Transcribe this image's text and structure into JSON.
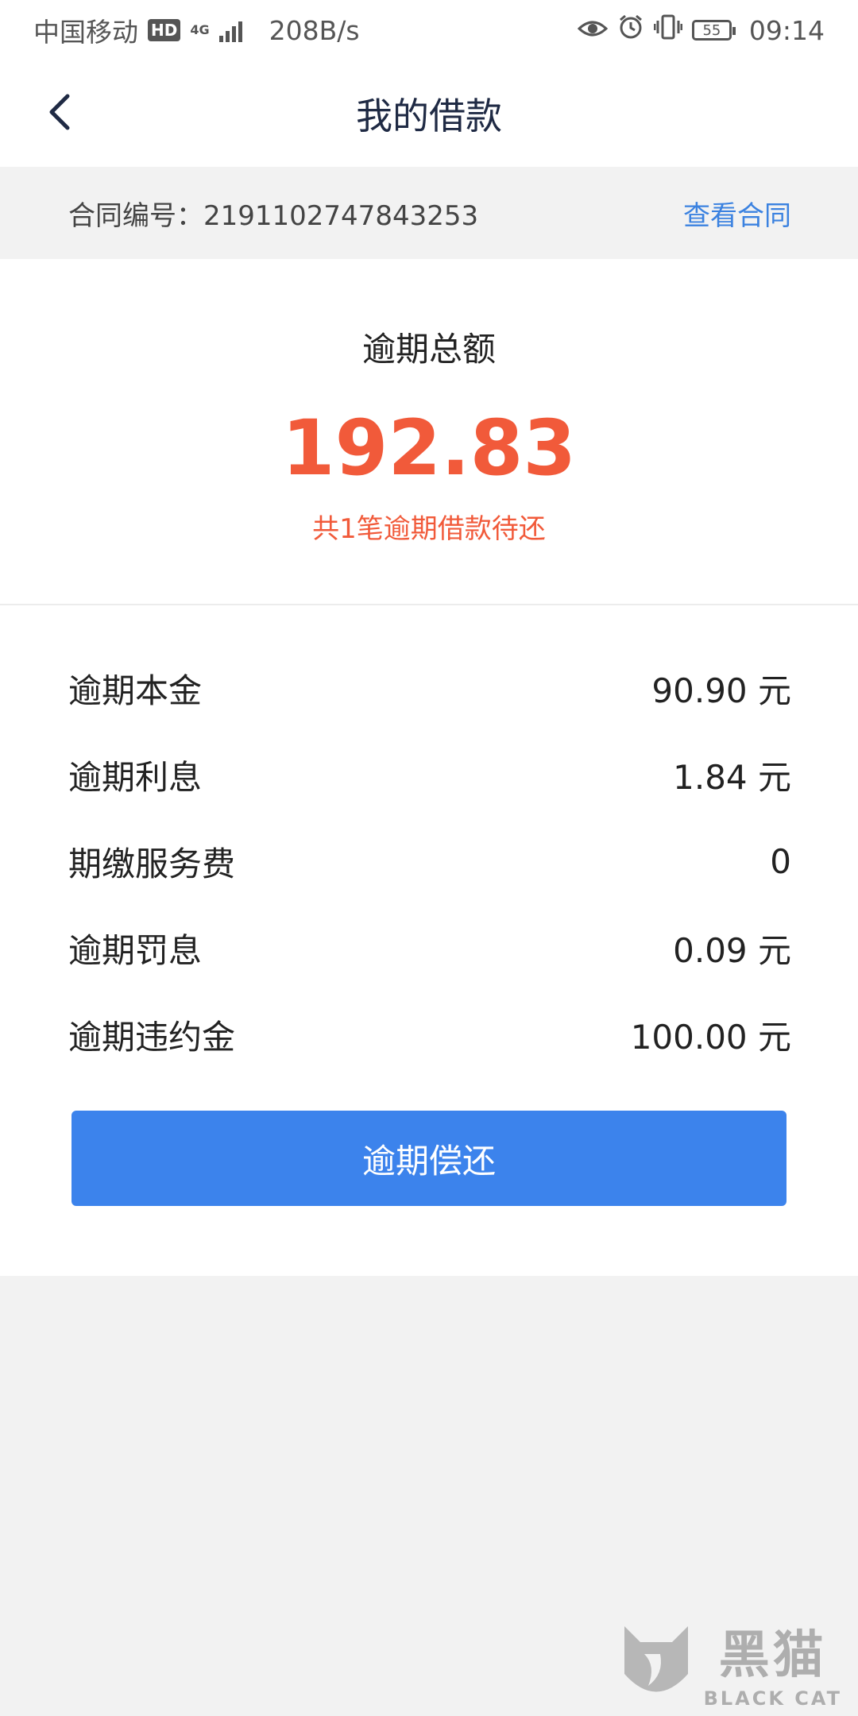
{
  "status_bar": {
    "carrier": "中国移动",
    "hd_badge": "HD",
    "network": "4G",
    "speed": "208B/s",
    "battery": "55",
    "time": "09:14",
    "icons": [
      "eye-icon",
      "alarm-icon",
      "vibrate-icon",
      "battery-icon"
    ]
  },
  "header": {
    "title": "我的借款",
    "back_icon": "chevron-left-icon"
  },
  "contract": {
    "label": "合同编号：2191102747843253",
    "view_link": "查看合同"
  },
  "summary": {
    "title": "逾期总额",
    "amount": "192.83",
    "subtitle": "共1笔逾期借款待还"
  },
  "details": [
    {
      "label": "逾期本金",
      "value": "90.90 元"
    },
    {
      "label": "逾期利息",
      "value": "1.84 元"
    },
    {
      "label": "期缴服务费",
      "value": "0"
    },
    {
      "label": "逾期罚息",
      "value": "0.09 元"
    },
    {
      "label": "逾期违约金",
      "value": "100.00 元"
    }
  ],
  "action": {
    "repay_label": "逾期偿还"
  },
  "watermark": {
    "cn": "黑猫",
    "en": "BLACK CAT"
  },
  "colors": {
    "accent_blue": "#3c83ec",
    "link_blue": "#3b82e0",
    "overdue_red": "#f15a3a",
    "background_gray": "#f2f2f2"
  }
}
